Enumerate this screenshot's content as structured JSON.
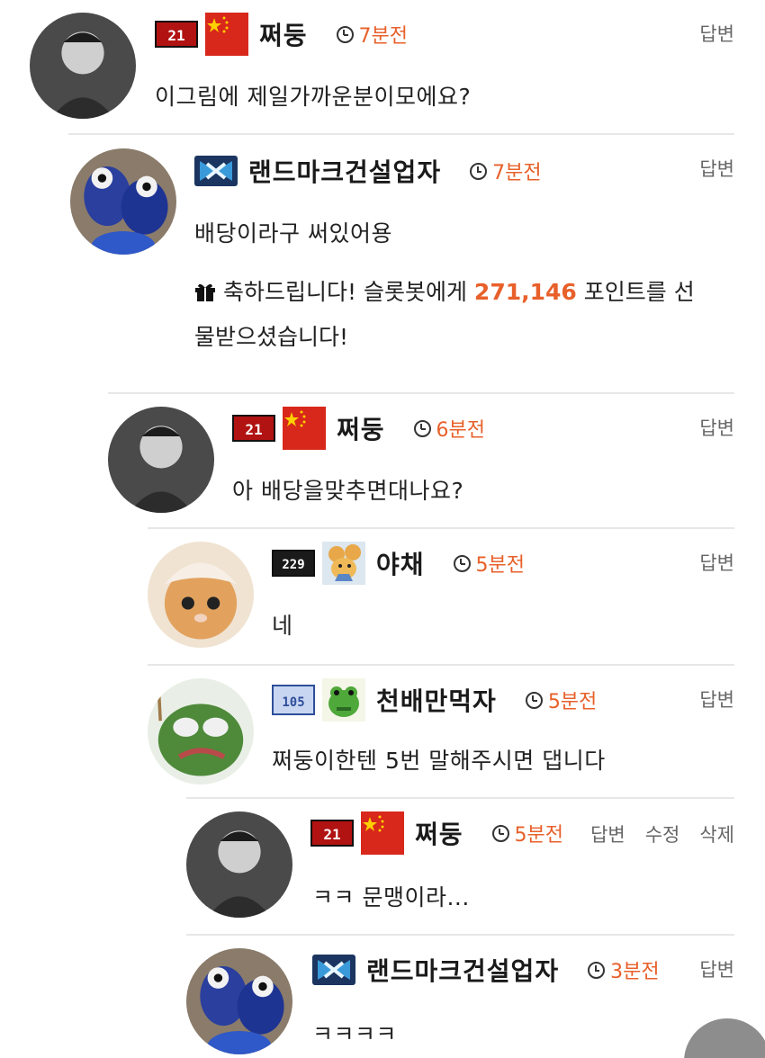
{
  "comments": [
    {
      "nickname": "쩌둥",
      "time": "7분전",
      "text": "이그림에 제일가까운분이모에요?",
      "actions": [
        "답변"
      ]
    },
    {
      "nickname": "랜드마크건설업자",
      "time": "7분전",
      "text": "배당이라구 써있어용",
      "gift": {
        "line1_before": "축하드립니다! 슬롯봇에게 ",
        "points": "271,146",
        "line1_after": " 포인트를 선",
        "line2": "물받으셨습니다!"
      },
      "actions": [
        "답변"
      ]
    },
    {
      "nickname": "쩌둥",
      "time": "6분전",
      "text": "아 배당을맞추면대나요?",
      "actions": [
        "답변"
      ]
    },
    {
      "nickname": "야채",
      "time": "5분전",
      "text": "네",
      "actions": [
        "답변"
      ]
    },
    {
      "nickname": "천배만먹자",
      "time": "5분전",
      "text": "쩌둥이한텐 5번 말해주시면 댑니다",
      "actions": [
        "답변"
      ]
    },
    {
      "nickname": "쩌둥",
      "time": "5분전",
      "text": "ㅋㅋ 문맹이라...",
      "actions": [
        "답변",
        "수정",
        "삭제"
      ]
    },
    {
      "nickname": "랜드마크건설업자",
      "time": "3분전",
      "text": "ㅋㅋㅋㅋ",
      "actions": [
        "답변"
      ]
    }
  ],
  "badges": {
    "level_21": "21",
    "level_229": "229",
    "level_105": "105"
  },
  "icons": {
    "accent_color": "#e8602a",
    "gift": "gift-icon",
    "clock": "clock-icon"
  }
}
